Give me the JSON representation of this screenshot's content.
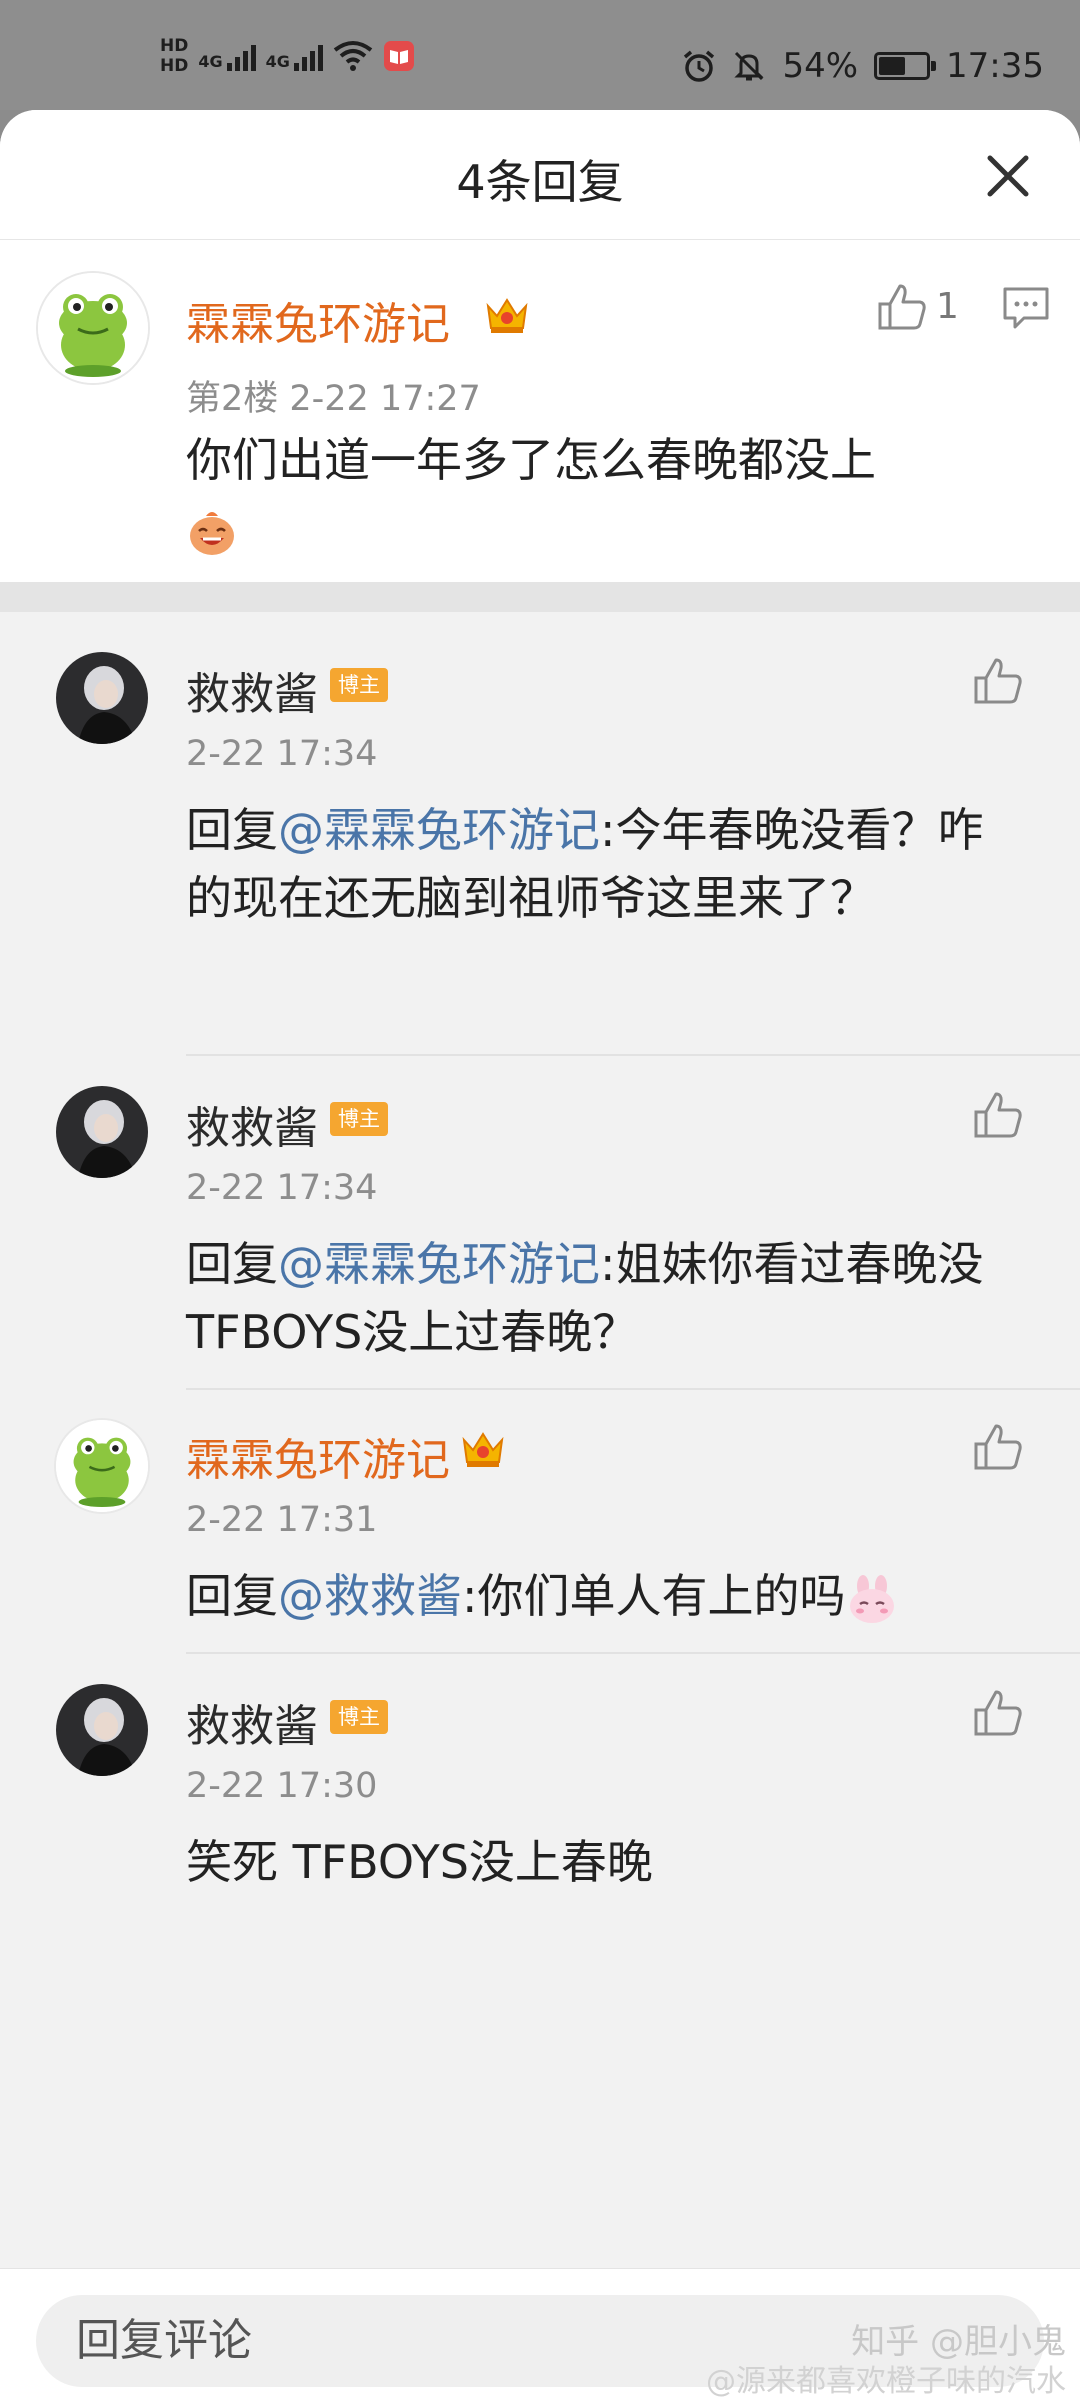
{
  "status_bar": {
    "hd1": "HD",
    "hd2": "HD",
    "net1": "4G",
    "net2": "4G",
    "battery_percent": "54%",
    "battery_level": 0.54,
    "time": "17:35"
  },
  "sheet": {
    "title": "4条回复",
    "close_icon": "close-icon"
  },
  "main_comment": {
    "author": "霖霖兔环游记",
    "floor_time": "第2楼 2-22 17:27",
    "text": "你们出道一年多了怎么春晚都没上",
    "like_count": "1"
  },
  "replies": [
    {
      "author": "救救酱",
      "badge": "博主",
      "time": "2-22 17:34",
      "prefix": "回复",
      "mention": "@霖霖兔环游记",
      "body": ":今年春晚没看？咋的现在还无脑到祖师爷这里来了？"
    },
    {
      "author": "救救酱",
      "badge": "博主",
      "time": "2-22 17:34",
      "prefix": "回复",
      "mention": "@霖霖兔环游记",
      "body": ":姐妹你看过春晚没TFBOYS没上过春晚？"
    },
    {
      "author": "霖霖兔环游记",
      "time": "2-22 17:31",
      "prefix": "回复",
      "mention": "@救救酱",
      "body": ":你们单人有上的吗"
    },
    {
      "author": "救救酱",
      "badge": "博主",
      "time": "2-22 17:30",
      "body": "笑死 TFBOYS没上春晚"
    }
  ],
  "bottom_bar": {
    "placeholder": "回复评论"
  },
  "watermark": {
    "line1": "知乎 @胆小鬼",
    "line2": "@源来都喜欢橙子味的汽水"
  },
  "colors": {
    "accent_orange": "#e1681d",
    "mention_blue": "#4a75a8",
    "badge_orange": "#f5a630"
  }
}
